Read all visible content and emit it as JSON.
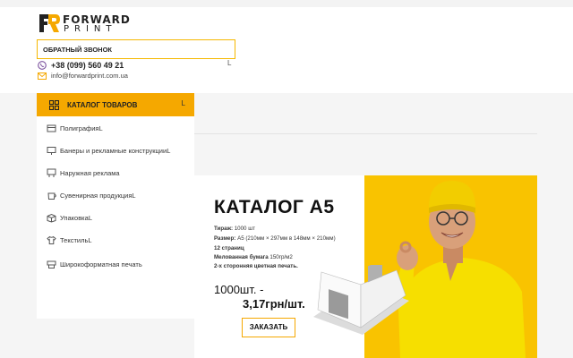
{
  "header": {
    "logo": {
      "word1": "FORWARD",
      "word2": "PRINT"
    },
    "callback_label": "ОБРАТНЫЙ ЗВОНОК",
    "phone": "+38 (099) 560 49 21",
    "email": "info@forwardprint.com.ua",
    "corner_mark": "L"
  },
  "catalog": {
    "label": "КАТАЛОГ ТОВАРОВ",
    "tick": "L",
    "items": [
      {
        "label": "Полиграфия",
        "suffix": "L"
      },
      {
        "label": "Банеры и рекламные конструкции",
        "suffix": "L"
      },
      {
        "label": "Наружная реклама",
        "suffix": ""
      },
      {
        "label": "Сувенирная продукция",
        "suffix": "L"
      },
      {
        "label": "Упаковка",
        "suffix": "L"
      },
      {
        "label": "Текстиль",
        "suffix": "L"
      },
      {
        "label": "Широкоформатная печать",
        "suffix": ""
      }
    ]
  },
  "banner": {
    "title": "КАТАЛОГ А5",
    "specs": [
      {
        "key": "Тираж:",
        "value": " 1000 шт"
      },
      {
        "key": "Размер:",
        "value": " А5 (210мм × 297мм в 148мм × 210мм)"
      },
      {
        "key": "12 страниц",
        "value": ""
      },
      {
        "key": "Мелованная бумага",
        "value": " 150гр/м2"
      },
      {
        "key": "2-х сторонняя цветная печать.",
        "value": ""
      }
    ],
    "price_line1": "1000шт. -",
    "price_line2": "3,17грн/шт.",
    "order_label": "ЗАКАЗАТЬ"
  },
  "colors": {
    "accent": "#f5a800",
    "accent_border": "#f6b800",
    "photo_bg": "#f9c300",
    "viber": "#7b519d"
  },
  "icons": [
    "logo-mark-icon",
    "viber-icon",
    "mail-icon",
    "grid-icon",
    "category-icon"
  ]
}
